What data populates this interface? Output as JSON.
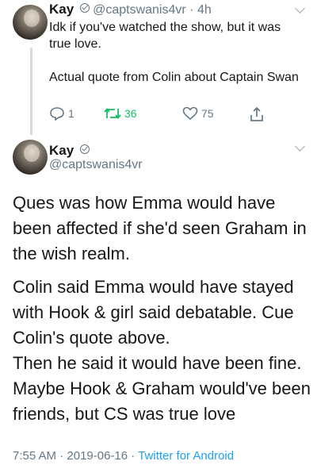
{
  "tweet1": {
    "name": "Kay",
    "handle": "@captswanis4vr",
    "time": "4h",
    "lines": [
      "Idk if you've watched the show, but it was true love.",
      "Actual quote from Colin about Captain Swan"
    ],
    "reply_count": "1",
    "retweet_count": "36",
    "like_count": "75"
  },
  "tweet2": {
    "name": "Kay",
    "handle": "@captswanis4vr",
    "paragraph1": "Ques was how Emma would have been affected if she'd seen Graham in the wish realm.",
    "paragraph2": "Colin said Emma would have stayed with Hook & girl said debatable. Cue Colin's quote above.",
    "paragraph3": "Then he said it would have been fine. Maybe Hook & Graham would've been friends, but CS was true love",
    "footer_time": "7:55 AM",
    "footer_date": "2019-06-16",
    "footer_source": "Twitter for Android"
  },
  "colors": {
    "accent": "#1da1f2",
    "retweet": "#17bf63",
    "muted": "#657786"
  }
}
